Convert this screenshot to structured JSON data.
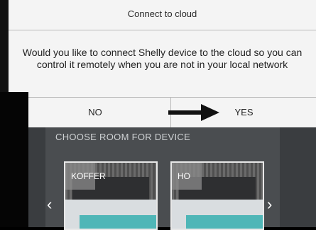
{
  "dialog": {
    "title": "Connect to cloud",
    "message": "Would you like to connect Shelly device to the cloud so you can control it remotely when you are not in your local network",
    "no_label": "NO",
    "yes_label": "YES"
  },
  "background": {
    "section_title": "CHOOSE ROOM FOR DEVICE",
    "rooms": [
      {
        "label": "KOFFER"
      },
      {
        "label": "HO"
      }
    ],
    "prev_glyph": "‹",
    "next_glyph": "›"
  },
  "colors": {
    "dialog_bg": "#f4f4f4",
    "app_bg": "#3a3d40",
    "accent_teal": "#4fb6b7"
  },
  "icons": [
    "arrow-right-icon",
    "chevron-left-icon",
    "chevron-right-icon"
  ]
}
